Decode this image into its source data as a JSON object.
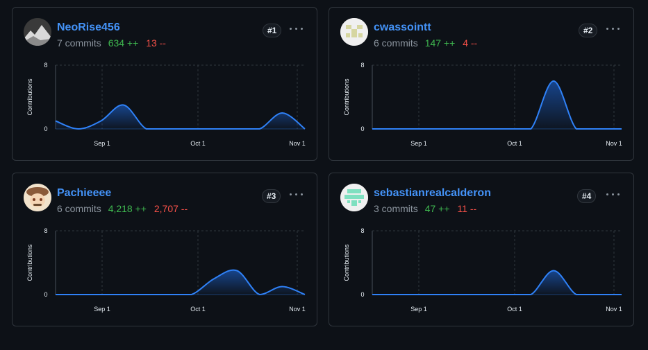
{
  "xaxis": {
    "labels": [
      "Sep 1",
      "Oct 1",
      "Nov 1"
    ]
  },
  "yaxis": {
    "label": "Contributions",
    "ticks": [
      "8",
      "0"
    ]
  },
  "contributors": [
    {
      "username": "NeoRise456",
      "commits": "7 commits",
      "additions": "634 ++",
      "deletions": "13 --",
      "rank": "#1",
      "avatar_icon": "mountain-photo-icon"
    },
    {
      "username": "cwassointt",
      "commits": "6 commits",
      "additions": "147 ++",
      "deletions": "4 --",
      "rank": "#2",
      "avatar_icon": "identicon-icon"
    },
    {
      "username": "Pachieeee",
      "commits": "6 commits",
      "additions": "4,218 ++",
      "deletions": "2,707 --",
      "rank": "#3",
      "avatar_icon": "anime-character-icon"
    },
    {
      "username": "sebastianrealcalderon",
      "commits": "3 commits",
      "additions": "47 ++",
      "deletions": "11 --",
      "rank": "#4",
      "avatar_icon": "identicon-icon"
    }
  ],
  "chart_data": [
    {
      "type": "area",
      "ylabel": "Contributions",
      "ylim": [
        0,
        8
      ],
      "x": [
        "Aug 17",
        "Aug 24",
        "Aug 31",
        "Sep 7",
        "Sep 14",
        "Sep 21",
        "Sep 28",
        "Oct 5",
        "Oct 12",
        "Oct 19",
        "Oct 26",
        "Nov 2"
      ],
      "values": [
        1,
        0,
        1,
        3,
        0,
        0,
        0,
        0,
        0,
        0,
        2,
        0
      ]
    },
    {
      "type": "area",
      "ylabel": "Contributions",
      "ylim": [
        0,
        8
      ],
      "x": [
        "Aug 17",
        "Aug 24",
        "Aug 31",
        "Sep 7",
        "Sep 14",
        "Sep 21",
        "Sep 28",
        "Oct 5",
        "Oct 12",
        "Oct 19",
        "Oct 26",
        "Nov 2"
      ],
      "values": [
        0,
        0,
        0,
        0,
        0,
        0,
        0,
        0,
        6,
        0,
        0,
        0
      ]
    },
    {
      "type": "area",
      "ylabel": "Contributions",
      "ylim": [
        0,
        8
      ],
      "x": [
        "Aug 17",
        "Aug 24",
        "Aug 31",
        "Sep 7",
        "Sep 14",
        "Sep 21",
        "Sep 28",
        "Oct 5",
        "Oct 12",
        "Oct 19",
        "Oct 26",
        "Nov 2"
      ],
      "values": [
        0,
        0,
        0,
        0,
        0,
        0,
        0,
        2,
        3,
        0,
        1,
        0
      ]
    },
    {
      "type": "area",
      "ylabel": "Contributions",
      "ylim": [
        0,
        8
      ],
      "x": [
        "Aug 17",
        "Aug 24",
        "Aug 31",
        "Sep 7",
        "Sep 14",
        "Sep 21",
        "Sep 28",
        "Oct 5",
        "Oct 12",
        "Oct 19",
        "Oct 26",
        "Nov 2"
      ],
      "values": [
        0,
        0,
        0,
        0,
        0,
        0,
        0,
        0,
        3,
        0,
        0,
        0
      ]
    }
  ]
}
